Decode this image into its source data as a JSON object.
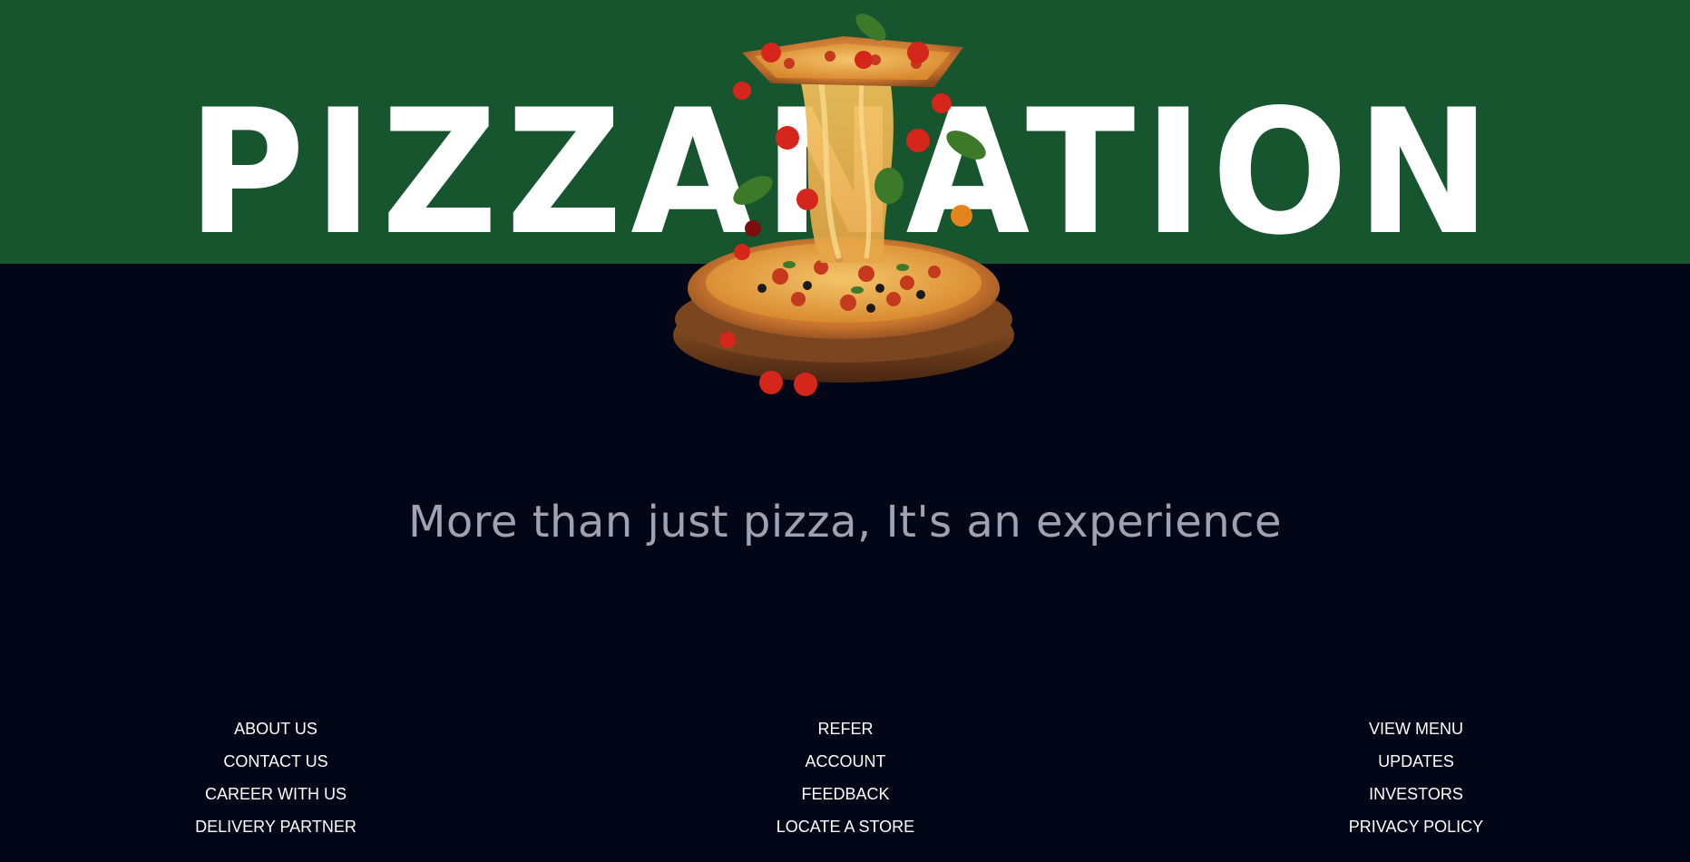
{
  "brand": {
    "title": "PIZZANATION",
    "colors": {
      "band": "#17552f",
      "background": "#020617",
      "title": "#ffffff",
      "tagline": "#9ea2b2"
    }
  },
  "hero": {
    "image": "pizza-cheese-pull-illustration",
    "tagline": "More than just pizza, It's an experience"
  },
  "footer": {
    "col1": [
      "ABOUT US",
      "CONTACT US",
      "CAREER WITH US",
      "DELIVERY PARTNER"
    ],
    "col2": [
      "REFER",
      "ACCOUNT",
      "FEEDBACK",
      "LOCATE A STORE"
    ],
    "col3": [
      "VIEW MENU",
      "UPDATES",
      "INVESTORS",
      "PRIVACY POLICY"
    ]
  }
}
